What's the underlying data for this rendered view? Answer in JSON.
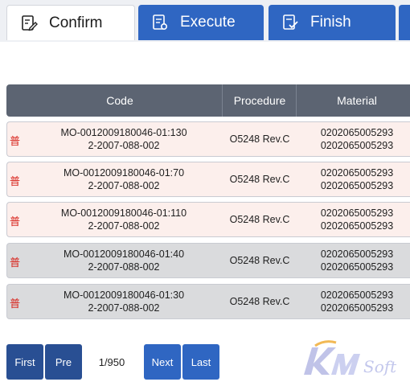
{
  "tabs": [
    {
      "label": "Confirm",
      "icon": "edit-document-icon",
      "active": true
    },
    {
      "label": "Execute",
      "icon": "document-settings-icon",
      "active": false
    },
    {
      "label": "Finish",
      "icon": "document-check-icon",
      "active": false
    }
  ],
  "table": {
    "columns": [
      "Code",
      "Procedure",
      "Material"
    ],
    "rows": [
      {
        "badge": "普",
        "code1": "MO-0012009180046-01:130",
        "code2": "2-2007-088-002",
        "procedure": "O5248 Rev.C",
        "material1": "0202065005293",
        "material2": "0202065005293",
        "shade": "pink"
      },
      {
        "badge": "普",
        "code1": "MO-0012009180046-01:70",
        "code2": "2-2007-088-002",
        "procedure": "O5248 Rev.C",
        "material1": "0202065005293",
        "material2": "0202065005293",
        "shade": "pink"
      },
      {
        "badge": "普",
        "code1": "MO-0012009180046-01:110",
        "code2": "2-2007-088-002",
        "procedure": "O5248 Rev.C",
        "material1": "0202065005293",
        "material2": "0202065005293",
        "shade": "pink"
      },
      {
        "badge": "普",
        "code1": "MO-0012009180046-01:40",
        "code2": "2-2007-088-002",
        "procedure": "O5248 Rev.C",
        "material1": "0202065005293",
        "material2": "0202065005293",
        "shade": "gray"
      },
      {
        "badge": "普",
        "code1": "MO-0012009180046-01:30",
        "code2": "2-2007-088-002",
        "procedure": "O5248 Rev.C",
        "material1": "0202065005293",
        "material2": "0202065005293",
        "shade": "gray"
      }
    ]
  },
  "pagination": {
    "first": "First",
    "prev": "Pre",
    "page_info": "1/950",
    "next": "Next",
    "last": "Last"
  },
  "logo": {
    "text": "KMSoft"
  },
  "colors": {
    "tab_blue": "#2f66c2",
    "header_gray": "#5c6472",
    "row_pink": "#fcefec",
    "row_gray": "#dadbdd",
    "badge_red": "#d8231b"
  }
}
